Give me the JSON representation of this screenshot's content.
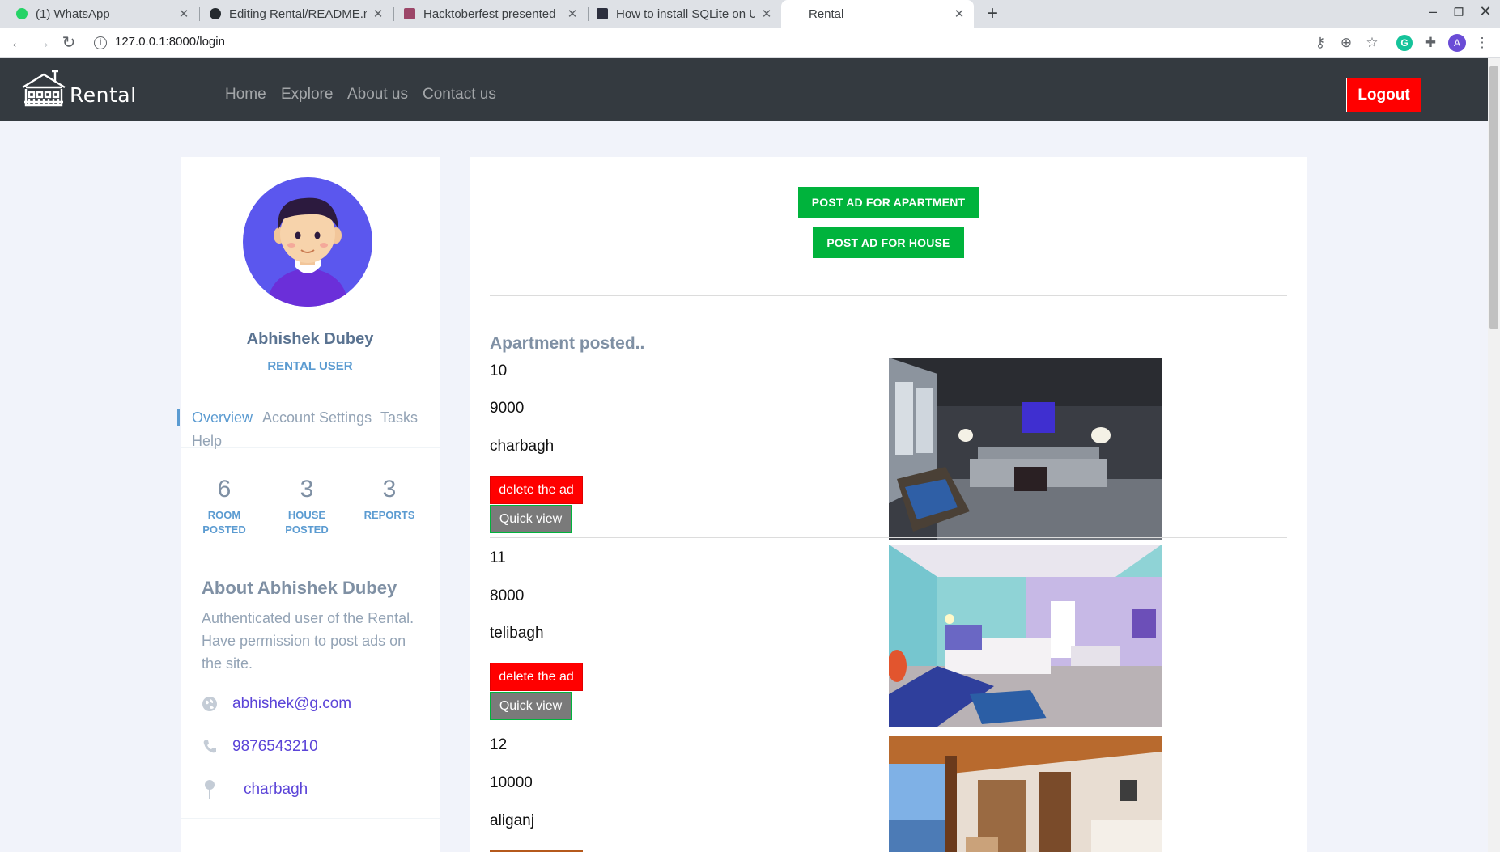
{
  "browser": {
    "tabs": [
      {
        "title": "(1) WhatsApp",
        "favicon_color": "#25d366"
      },
      {
        "title": "Editing Rental/README.md",
        "favicon_color": "#24292e"
      },
      {
        "title": "Hacktoberfest presented",
        "favicon_color": "#9c4668"
      },
      {
        "title": "How to install SQLite on U",
        "favicon_color": "#2c2f3e"
      },
      {
        "title": "Rental",
        "favicon_color": "#ffffff"
      }
    ],
    "active_tab": 4,
    "url": "127.0.0.1:8000/login",
    "profile_initial": "A",
    "grammarly_letter": "G"
  },
  "nav": {
    "brand": "Rental",
    "links": [
      "Home",
      "Explore",
      "About us",
      "Contact us"
    ],
    "logout_label": "Logout"
  },
  "profile": {
    "name": "Abhishek Dubey",
    "role": "RENTAL USER",
    "tabs": [
      "Overview",
      "Account Settings",
      "Tasks",
      "Help"
    ],
    "active_tab": "Overview",
    "stats": [
      {
        "value": "6",
        "label_line1": "ROOM",
        "label_line2": "POSTED"
      },
      {
        "value": "3",
        "label_line1": "HOUSE",
        "label_line2": "POSTED"
      },
      {
        "value": "3",
        "label_line1": "REPORTS",
        "label_line2": ""
      }
    ],
    "about_title": "About Abhishek Dubey",
    "about_text": "Authenticated user of the Rental. Have permission to post ads on the site.",
    "email": "abhishek@g.com",
    "phone": "9876543210",
    "location": "charbagh"
  },
  "actions": {
    "post_apartment": "POST AD FOR APARTMENT",
    "post_house": "POST AD FOR HOUSE"
  },
  "listings": {
    "section_title": "Apartment posted..",
    "delete_label": "delete the ad",
    "quickview_label": "Quick view",
    "items": [
      {
        "id": "10",
        "price": "9000",
        "location": "charbagh"
      },
      {
        "id": "11",
        "price": "8000",
        "location": "telibagh"
      },
      {
        "id": "12",
        "price": "10000",
        "location": "aliganj"
      }
    ]
  },
  "colors": {
    "navbar": "#343a40",
    "logout": "#ff0000",
    "post_button": "#00b33c",
    "delete_button": "#ff0000",
    "quickview_button": "#7a7a7a",
    "link": "#5b44d8",
    "accent": "#5b9bd1"
  }
}
